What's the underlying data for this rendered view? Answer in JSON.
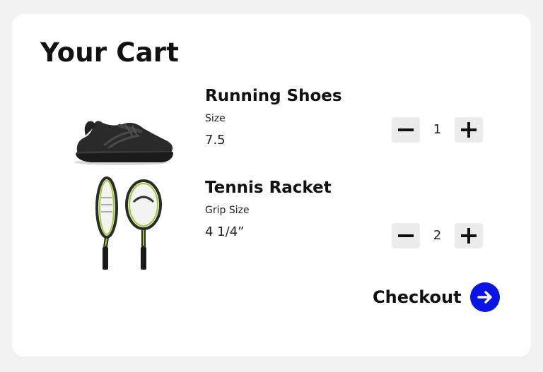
{
  "page": {
    "title": "Your Cart"
  },
  "cart": {
    "items": [
      {
        "name": "Running Shoes",
        "image_icon": "running-shoe-image",
        "option_label": "Size",
        "option_value": "7.5",
        "quantity": "1"
      },
      {
        "name": "Tennis Racket",
        "image_icon": "tennis-racket-image",
        "option_label": "Grip Size",
        "option_value": "4 1/4”",
        "quantity": "2"
      }
    ]
  },
  "checkout": {
    "label": "Checkout",
    "icon": "arrow-right-icon"
  },
  "colors": {
    "accent": "#0a14e6",
    "qty_button_bg": "#ebebeb",
    "background": "#f1f1f1",
    "card": "#ffffff"
  }
}
